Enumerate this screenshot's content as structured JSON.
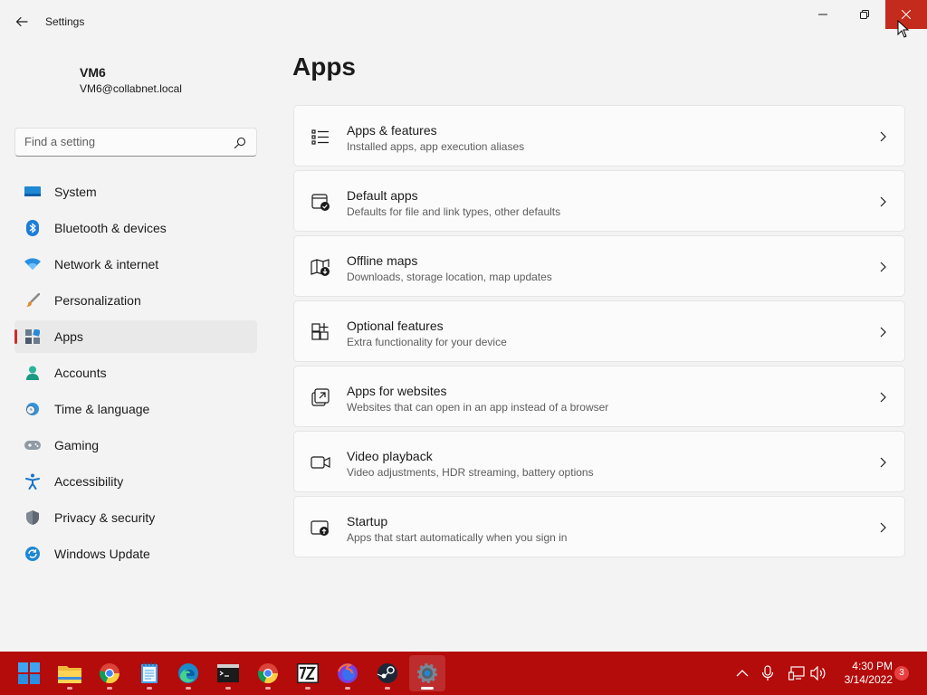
{
  "window": {
    "title": "Settings"
  },
  "profile": {
    "name": "VM6",
    "email": "VM6@collabnet.local"
  },
  "search": {
    "placeholder": "Find a setting"
  },
  "sidebar": {
    "items": [
      {
        "label": "System",
        "icon": "system-icon"
      },
      {
        "label": "Bluetooth & devices",
        "icon": "bluetooth-icon"
      },
      {
        "label": "Network & internet",
        "icon": "wifi-icon"
      },
      {
        "label": "Personalization",
        "icon": "brush-icon"
      },
      {
        "label": "Apps",
        "icon": "apps-icon",
        "selected": true
      },
      {
        "label": "Accounts",
        "icon": "person-icon"
      },
      {
        "label": "Time & language",
        "icon": "globe-clock-icon"
      },
      {
        "label": "Gaming",
        "icon": "gamepad-icon"
      },
      {
        "label": "Accessibility",
        "icon": "accessibility-icon"
      },
      {
        "label": "Privacy & security",
        "icon": "shield-icon"
      },
      {
        "label": "Windows Update",
        "icon": "update-icon"
      }
    ]
  },
  "main": {
    "title": "Apps",
    "cards": [
      {
        "title": "Apps & features",
        "description": "Installed apps, app execution aliases",
        "icon": "list-icon"
      },
      {
        "title": "Default apps",
        "description": "Defaults for file and link types, other defaults",
        "icon": "default-apps-icon"
      },
      {
        "title": "Offline maps",
        "description": "Downloads, storage location, map updates",
        "icon": "map-download-icon"
      },
      {
        "title": "Optional features",
        "description": "Extra functionality for your device",
        "icon": "grid-add-icon"
      },
      {
        "title": "Apps for websites",
        "description": "Websites that can open in an app instead of a browser",
        "icon": "open-external-icon"
      },
      {
        "title": "Video playback",
        "description": "Video adjustments, HDR streaming, battery options",
        "icon": "video-icon"
      },
      {
        "title": "Startup",
        "description": "Apps that start automatically when you sign in",
        "icon": "startup-icon"
      }
    ]
  },
  "taskbar": {
    "apps": [
      "start-icon",
      "file-explorer-icon",
      "chrome-icon",
      "notepad-icon",
      "edge-icon",
      "terminal-icon",
      "chrome-icon",
      "7zip-icon",
      "firefox-icon",
      "steam-icon",
      "settings-icon"
    ],
    "active_app": "settings-icon",
    "time": "4:30 PM",
    "date": "3/14/2022",
    "notification_count": "3"
  },
  "colors": {
    "accent": "#d02a2a",
    "taskbar": "#b40b0b",
    "close_button": "#c42b1c",
    "background": "#f3f3f3",
    "card": "#fbfbfb"
  }
}
